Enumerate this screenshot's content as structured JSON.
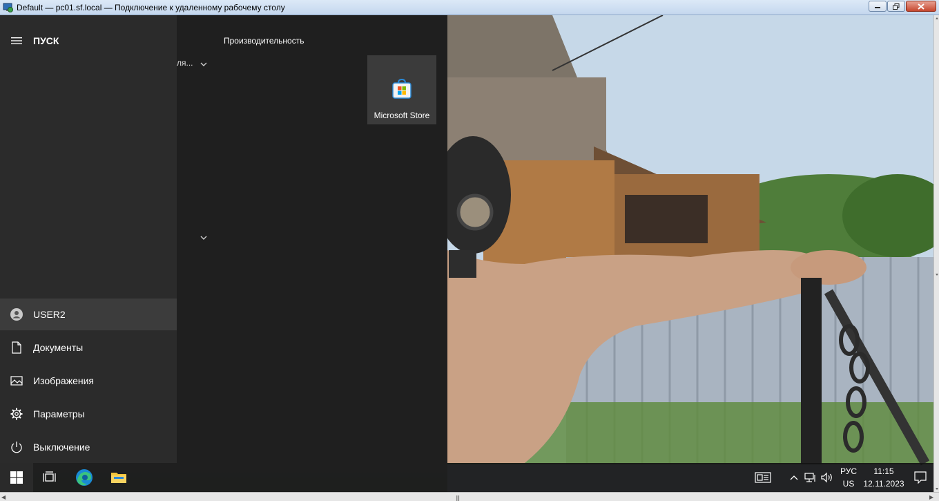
{
  "window": {
    "title": "Default — pc01.sf.local — Подключение к удаленному рабочему столу"
  },
  "start_menu": {
    "header_label": "ПУСК",
    "nav_items": [
      {
        "label": "USER2",
        "icon": "user-icon"
      },
      {
        "label": "Документы",
        "icon": "document-icon"
      },
      {
        "label": "Изображения",
        "icon": "pictures-icon"
      },
      {
        "label": "Параметры",
        "icon": "gear-icon"
      },
      {
        "label": "Выключение",
        "icon": "power-icon"
      }
    ],
    "list_truncated_text": "ля...",
    "tiles_group_title": "Производительность",
    "tiles": [
      {
        "label": "Microsoft Store",
        "icon": "store-bag-icon"
      }
    ]
  },
  "taskbar": {
    "apps": [
      "start-icon",
      "task-view-icon",
      "edge-icon",
      "file-explorer-icon"
    ],
    "tray": {
      "lang_primary": "РУС",
      "lang_secondary": "US",
      "time": "11:15",
      "date": "12.11.2023"
    }
  },
  "colors": {
    "start_nav_bg": "#2b2b2b",
    "start_tiles_bg": "#1f1f1f",
    "taskbar_bg": "#141414",
    "accent_edge": "#1a8ad4",
    "explorer_folder": "#f2c33a"
  }
}
